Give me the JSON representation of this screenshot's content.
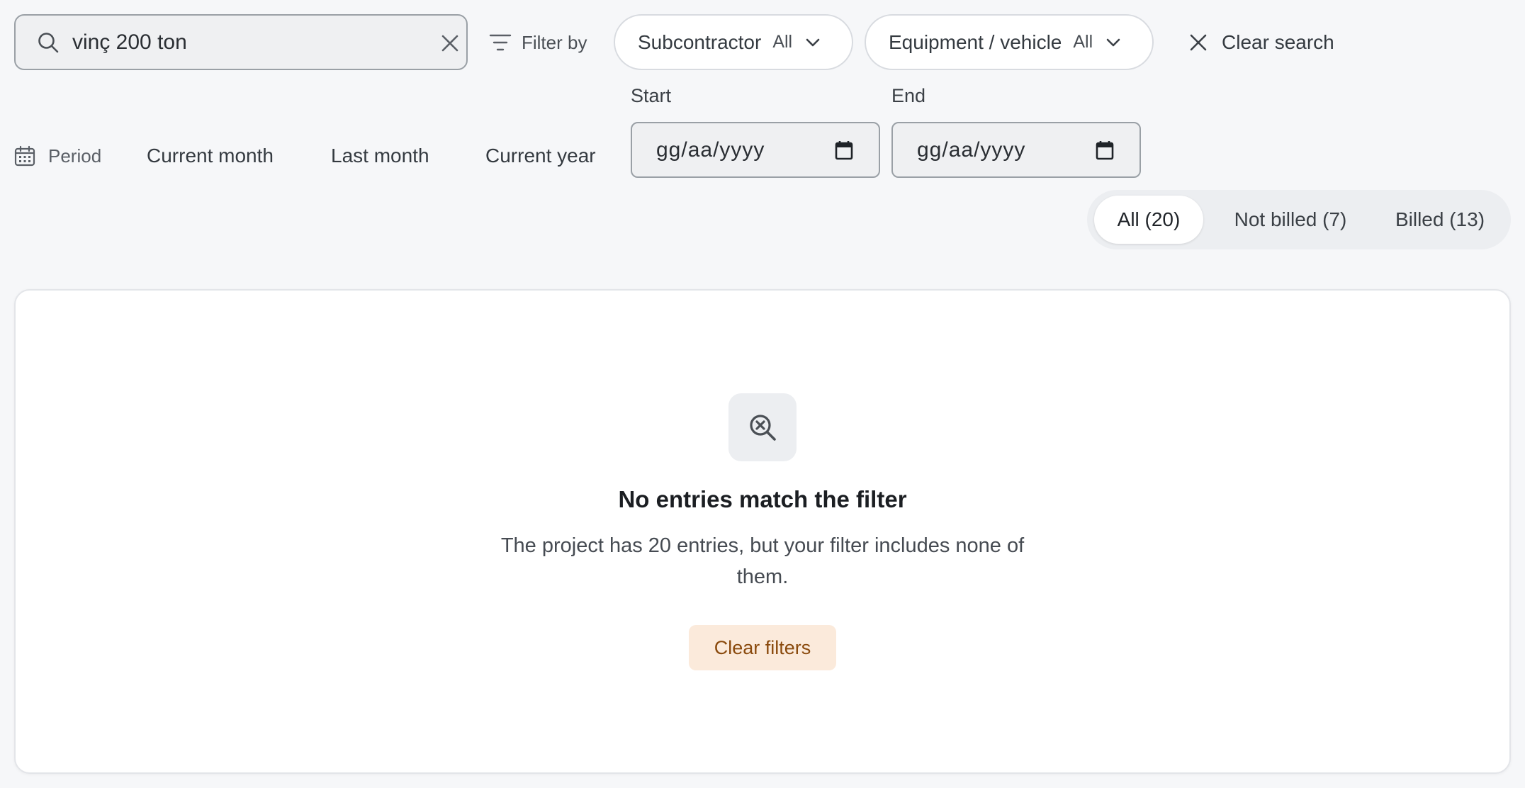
{
  "search": {
    "value": "vinç 200 ton"
  },
  "filters": {
    "filter_by_label": "Filter by",
    "subcontractor": {
      "label": "Subcontractor",
      "value": "All"
    },
    "equipment": {
      "label": "Equipment / vehicle",
      "value": "All"
    },
    "clear_search_label": "Clear search"
  },
  "period": {
    "label": "Period",
    "quick_options": [
      "Current month",
      "Last month",
      "Current year"
    ],
    "start": {
      "label": "Start",
      "placeholder": "gg/aa/yyyy"
    },
    "end": {
      "label": "End",
      "placeholder": "gg/aa/yyyy"
    }
  },
  "billing_tabs": [
    {
      "label": "All (20)",
      "active": true
    },
    {
      "label": "Not billed (7)",
      "active": false
    },
    {
      "label": "Billed (13)",
      "active": false
    }
  ],
  "empty_state": {
    "icon": "search-x-icon",
    "title": "No entries match the filter",
    "description": "The project has 20 entries, but your filter includes none of them.",
    "button_label": "Clear filters"
  },
  "colors": {
    "background": "#f6f7f9",
    "accent_button_bg": "#fbeadb",
    "accent_button_text": "#8a4a0d"
  }
}
